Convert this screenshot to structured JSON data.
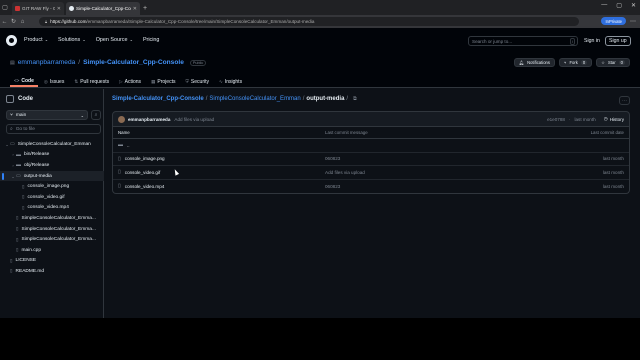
{
  "browser": {
    "tabs": [
      {
        "label": "GIT RAW Fly - GitHub Raw Link Genera...",
        "active": false
      },
      {
        "label": "Simple-Calculator_Cpp-Console/out...",
        "active": true
      }
    ],
    "address": {
      "host": "https://github.com",
      "path": "/emmanpbarrameda/Simple-Calculator_Cpp-Console/tree/main/SimpleConsoleCalculator_Emman/output-media"
    },
    "inprivate_label": "InPrivate"
  },
  "github_header": {
    "nav": [
      "Product",
      "Solutions",
      "Open Source",
      "Pricing"
    ],
    "search_placeholder": "Search or jump to...",
    "search_shortcut": "/",
    "sign_in": "Sign in",
    "sign_up": "Sign up"
  },
  "repo": {
    "owner": "emmanpbarrameda",
    "name": "Simple-Calculator_Cpp-Console",
    "visibility": "Public",
    "notifications_label": "Notifications",
    "fork_label": "Fork",
    "fork_count": "0",
    "star_label": "Star",
    "star_count": "0",
    "tabs": [
      {
        "label": "Code",
        "icon": "code-icon"
      },
      {
        "label": "Issues",
        "icon": "issue-icon"
      },
      {
        "label": "Pull requests",
        "icon": "pull-request-icon"
      },
      {
        "label": "Actions",
        "icon": "actions-icon"
      },
      {
        "label": "Projects",
        "icon": "projects-icon"
      },
      {
        "label": "Security",
        "icon": "security-icon"
      },
      {
        "label": "Insights",
        "icon": "insights-icon"
      }
    ]
  },
  "sidebar": {
    "title": "Code",
    "branch": "main",
    "goto_placeholder": "Go to file",
    "tree": [
      {
        "label": "SimpleConsoleCalculator_Emman",
        "type": "folder",
        "depth": 0,
        "open": true
      },
      {
        "label": "bin/Release",
        "type": "folder",
        "depth": 1,
        "open": false
      },
      {
        "label": "obj/Release",
        "type": "folder",
        "depth": 1,
        "open": false
      },
      {
        "label": "output-media",
        "type": "folder",
        "depth": 1,
        "open": true,
        "selected": true
      },
      {
        "label": "console_image.png",
        "type": "file",
        "depth": 2
      },
      {
        "label": "console_video.gif",
        "type": "file",
        "depth": 2
      },
      {
        "label": "console_video.mp4",
        "type": "file",
        "depth": 2
      },
      {
        "label": "SimpleConsoleCalculator_Emma...",
        "type": "file",
        "depth": 1
      },
      {
        "label": "SimpleConsoleCalculator_Emma...",
        "type": "file",
        "depth": 1
      },
      {
        "label": "SimpleConsoleCalculator_Emma...",
        "type": "file",
        "depth": 1
      },
      {
        "label": "main.cpp",
        "type": "file",
        "depth": 1
      },
      {
        "label": "LICENSE",
        "type": "file",
        "depth": 0
      },
      {
        "label": "README.md",
        "type": "file",
        "depth": 0
      }
    ]
  },
  "main": {
    "breadcrumb": {
      "repo": "Simple-Calculator_Cpp-Console",
      "folder": "SimpleConsoleCalculator_Emman",
      "current": "output-media",
      "sep": "/"
    },
    "commit": {
      "user": "emmanpbarrameda",
      "message": "Add files via upload",
      "hash": "e1e0788",
      "time": "last month",
      "history_label": "History"
    },
    "table": {
      "headers": {
        "name": "Name",
        "message": "Last commit message",
        "date": "Last commit date"
      },
      "rows": [
        {
          "name": "..",
          "type": "folder",
          "message": "",
          "date": ""
        },
        {
          "name": "console_image.png",
          "type": "file",
          "message": "060823",
          "date": "last month"
        },
        {
          "name": "console_video.gif",
          "type": "file",
          "message": "Add files via upload",
          "date": "last month"
        },
        {
          "name": "console_video.mp4",
          "type": "file",
          "message": "060823",
          "date": "last month"
        }
      ]
    }
  }
}
